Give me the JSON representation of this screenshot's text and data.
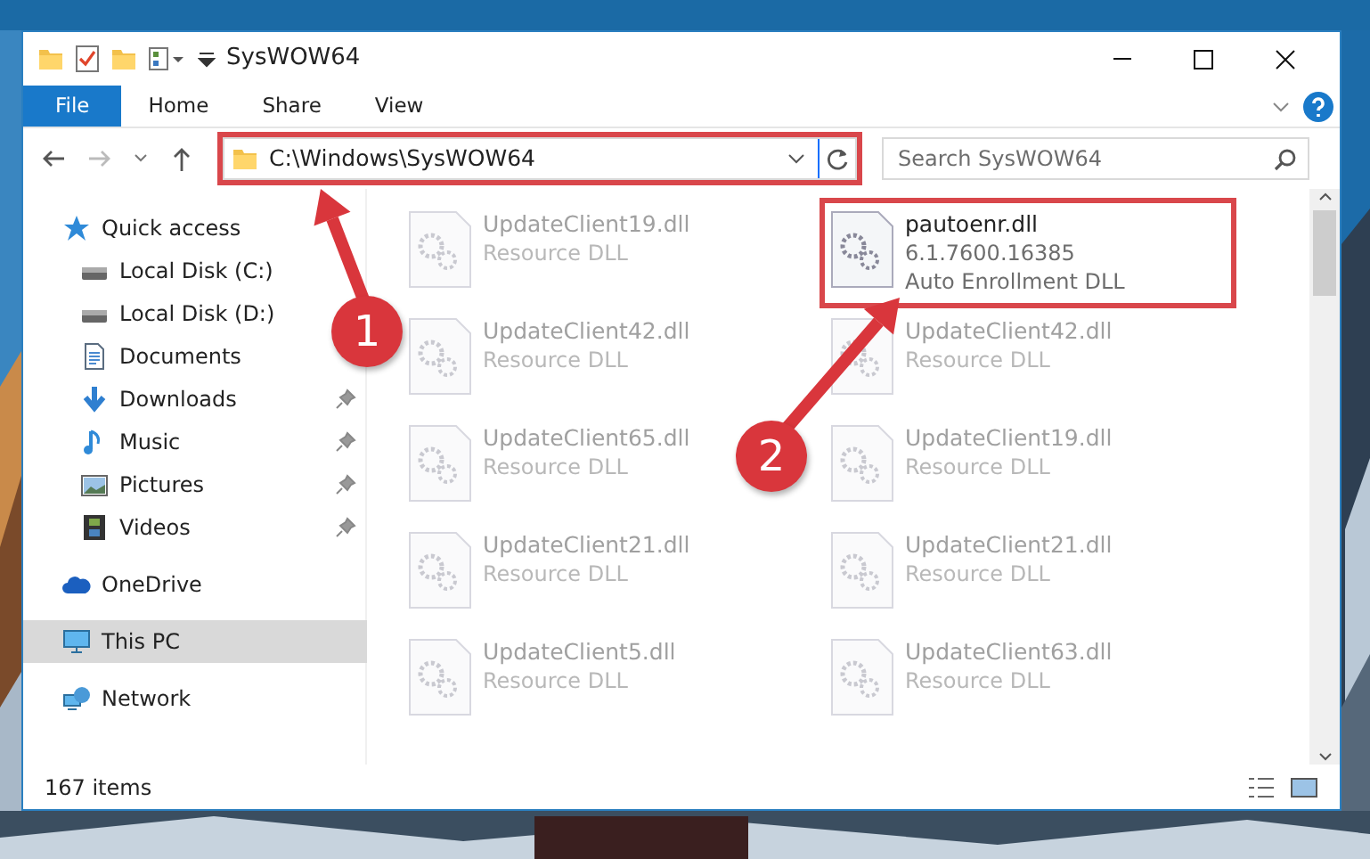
{
  "window": {
    "title": "SysWOW64"
  },
  "ribbon_tabs": [
    {
      "label": "File",
      "selected": true
    },
    {
      "label": "Home",
      "selected": false
    },
    {
      "label": "Share",
      "selected": false
    },
    {
      "label": "View",
      "selected": false
    }
  ],
  "address_bar": {
    "path": "C:\\Windows\\SysWOW64",
    "outlined": true
  },
  "search": {
    "placeholder": "Search SysWOW64"
  },
  "navigation_pane": [
    {
      "label": "Quick access",
      "kind": "star",
      "selected": false,
      "children": [
        {
          "label": "Local Disk (C:)",
          "kind": "drive",
          "pinned": false
        },
        {
          "label": "Local Disk (D:)",
          "kind": "drive",
          "pinned": false
        },
        {
          "label": "Documents",
          "kind": "documents",
          "pinned": false
        },
        {
          "label": "Downloads",
          "kind": "downloads",
          "pinned": true
        },
        {
          "label": "Music",
          "kind": "music",
          "pinned": true
        },
        {
          "label": "Pictures",
          "kind": "pictures",
          "pinned": true
        },
        {
          "label": "Videos",
          "kind": "videos",
          "pinned": true
        }
      ]
    },
    {
      "label": "OneDrive",
      "kind": "cloud",
      "selected": false
    },
    {
      "label": "This PC",
      "kind": "computer",
      "selected": true
    },
    {
      "label": "Network",
      "kind": "network",
      "selected": false
    }
  ],
  "files": [
    {
      "name": "UpdateClient19.dll",
      "details": [
        "Resource DLL"
      ],
      "faded": true,
      "outlined": false
    },
    {
      "name": "pautoenr.dll",
      "details": [
        "6.1.7600.16385",
        "Auto Enrollment DLL"
      ],
      "faded": false,
      "outlined": true
    },
    {
      "name": "UpdateClient42.dll",
      "details": [
        "Resource DLL"
      ],
      "faded": true,
      "outlined": false
    },
    {
      "name": "UpdateClient42.dll",
      "details": [
        "Resource DLL"
      ],
      "faded": true,
      "outlined": false
    },
    {
      "name": "UpdateClient65.dll",
      "details": [
        "Resource DLL"
      ],
      "faded": true,
      "outlined": false
    },
    {
      "name": "UpdateClient19.dll",
      "details": [
        "Resource DLL"
      ],
      "faded": true,
      "outlined": false
    },
    {
      "name": "UpdateClient21.dll",
      "details": [
        "Resource DLL"
      ],
      "faded": true,
      "outlined": false
    },
    {
      "name": "UpdateClient21.dll",
      "details": [
        "Resource DLL"
      ],
      "faded": true,
      "outlined": false
    },
    {
      "name": "UpdateClient5.dll",
      "details": [
        "Resource DLL"
      ],
      "faded": true,
      "outlined": false
    },
    {
      "name": "UpdateClient63.dll",
      "details": [
        "Resource DLL"
      ],
      "faded": true,
      "outlined": false
    }
  ],
  "status_bar": {
    "item_count": "167 items"
  },
  "annotations": [
    {
      "number": "1"
    },
    {
      "number": "2"
    }
  ]
}
